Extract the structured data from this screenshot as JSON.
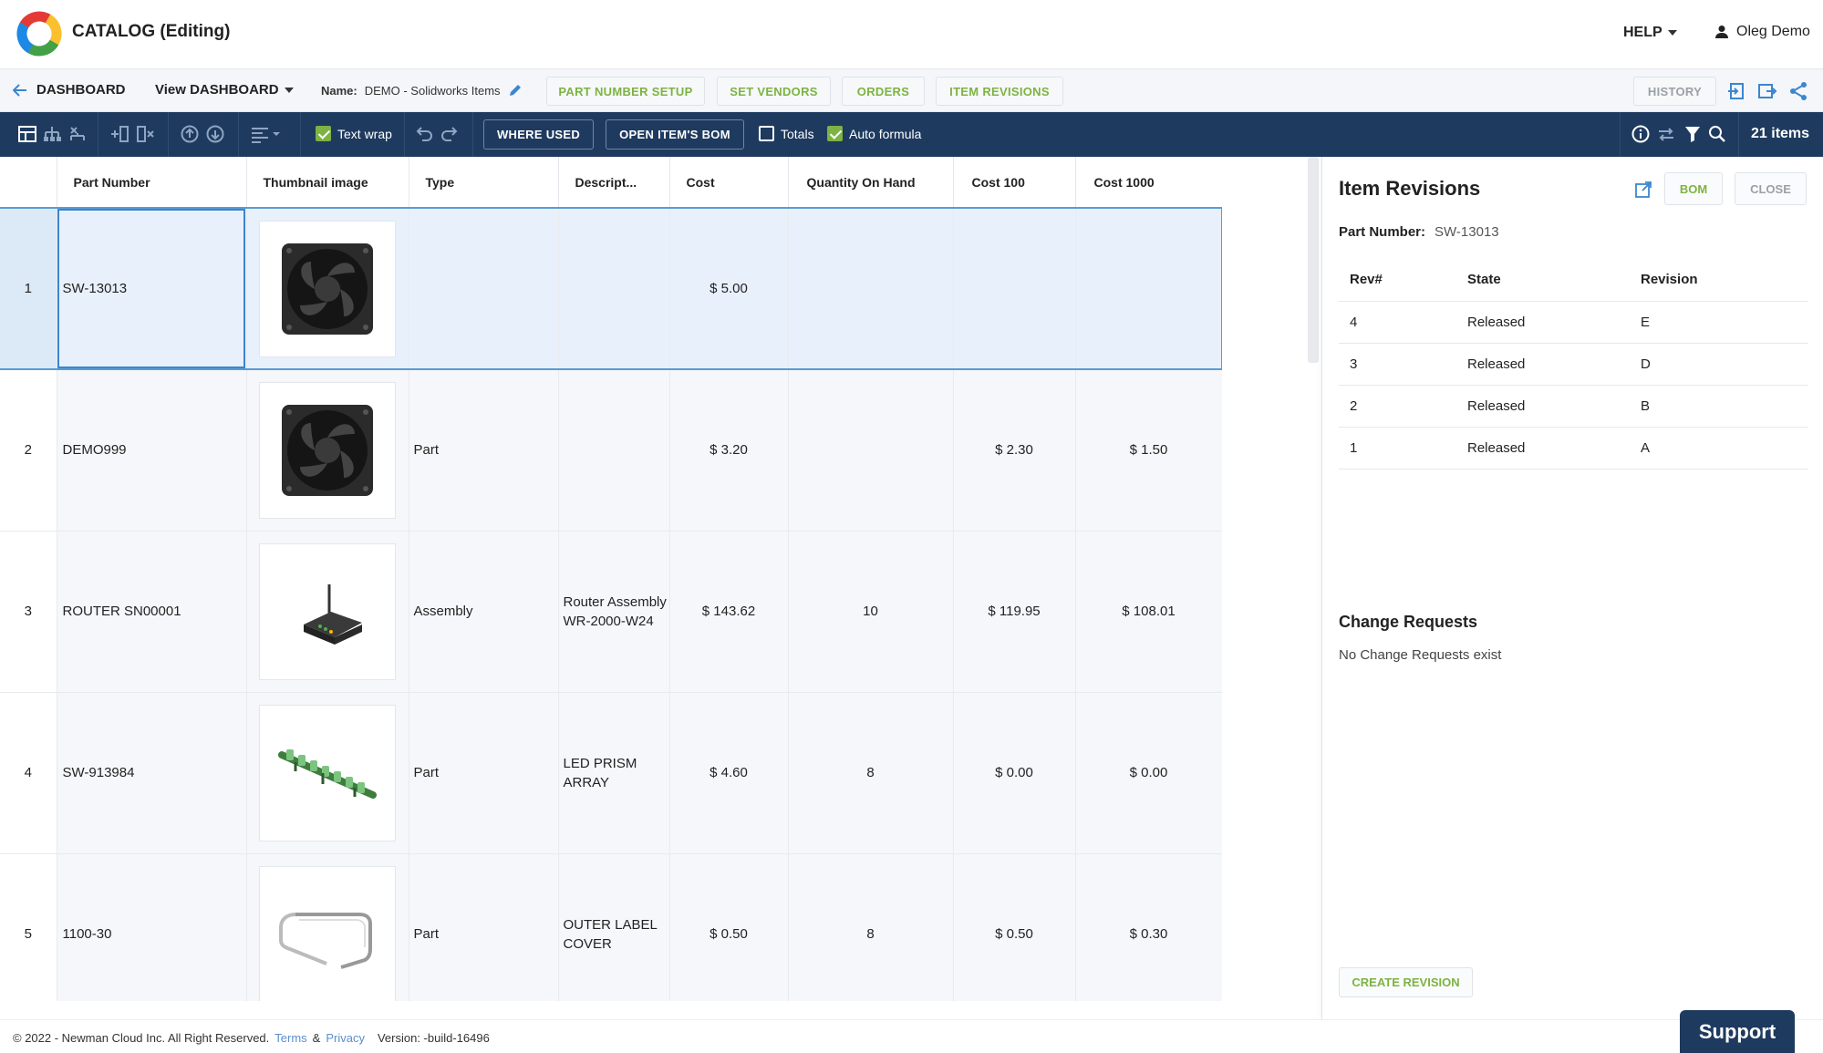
{
  "header": {
    "app_title": "CATALOG (Editing)",
    "help_label": "HELP",
    "user_name": "Oleg Demo"
  },
  "subbar": {
    "back_label": "DASHBOARD",
    "view_prefix": "View",
    "view_value": "DASHBOARD",
    "name_label": "Name:",
    "name_value": "DEMO - Solidworks Items",
    "tabs": [
      "PART NUMBER SETUP",
      "SET VENDORS",
      "ORDERS",
      "ITEM REVISIONS"
    ],
    "history_label": "HISTORY"
  },
  "toolbar": {
    "text_wrap_label": "Text wrap",
    "text_wrap_checked": true,
    "where_used_label": "WHERE USED",
    "open_bom_label": "OPEN ITEM'S BOM",
    "totals_label": "Totals",
    "totals_checked": false,
    "auto_formula_label": "Auto formula",
    "auto_formula_checked": true,
    "items_count": "21 items"
  },
  "grid": {
    "columns": [
      "Part Number",
      "Thumbnail image",
      "Type",
      "Descript...",
      "Cost",
      "Quantity On Hand",
      "Cost 100",
      "Cost 1000"
    ],
    "rows": [
      {
        "num": "1",
        "part_number": "SW-13013",
        "thumb": "fan",
        "type": "",
        "desc": "",
        "cost": "$ 5.00",
        "qty": "",
        "cost100": "",
        "cost1000": "",
        "selected": true
      },
      {
        "num": "2",
        "part_number": "DEMO999",
        "thumb": "fan",
        "type": "Part",
        "desc": "",
        "cost": "$ 3.20",
        "qty": "",
        "cost100": "$ 2.30",
        "cost1000": "$ 1.50"
      },
      {
        "num": "3",
        "part_number": "ROUTER SN00001",
        "thumb": "router",
        "type": "Assembly",
        "desc": "Router Assembly WR-2000-W24",
        "cost": "$ 143.62",
        "qty": "10",
        "cost100": "$ 119.95",
        "cost1000": "$ 108.01"
      },
      {
        "num": "4",
        "part_number": "SW-913984",
        "thumb": "led-array",
        "type": "Part",
        "desc": "LED PRISM ARRAY",
        "cost": "$ 4.60",
        "qty": "8",
        "cost100": "$ 0.00",
        "cost1000": "$ 0.00"
      },
      {
        "num": "5",
        "part_number": "1100-30",
        "thumb": "cover",
        "type": "Part",
        "desc": "OUTER LABEL COVER",
        "cost": "$ 0.50",
        "qty": "8",
        "cost100": "$ 0.50",
        "cost1000": "$ 0.30"
      }
    ]
  },
  "panel": {
    "title": "Item Revisions",
    "bom_label": "BOM",
    "close_label": "CLOSE",
    "part_number_label": "Part Number:",
    "part_number_value": "SW-13013",
    "rev_columns": [
      "Rev#",
      "State",
      "Revision"
    ],
    "revisions": [
      {
        "rev": "4",
        "state": "Released",
        "revision": "E"
      },
      {
        "rev": "3",
        "state": "Released",
        "revision": "D"
      },
      {
        "rev": "2",
        "state": "Released",
        "revision": "B"
      },
      {
        "rev": "1",
        "state": "Released",
        "revision": "A"
      }
    ],
    "change_requests_title": "Change Requests",
    "change_requests_empty": "No Change Requests exist",
    "create_revision_label": "CREATE REVISION"
  },
  "footer": {
    "copyright": "© 2022 - Newman Cloud Inc. All Right Reserved.",
    "terms": "Terms",
    "amp": "&",
    "privacy": "Privacy",
    "version": "Version: -build-16496"
  },
  "support_label": "Support",
  "colors": {
    "accent": "#7cb342",
    "navy": "#1e3a5f",
    "selection": "#5a9bd5"
  }
}
